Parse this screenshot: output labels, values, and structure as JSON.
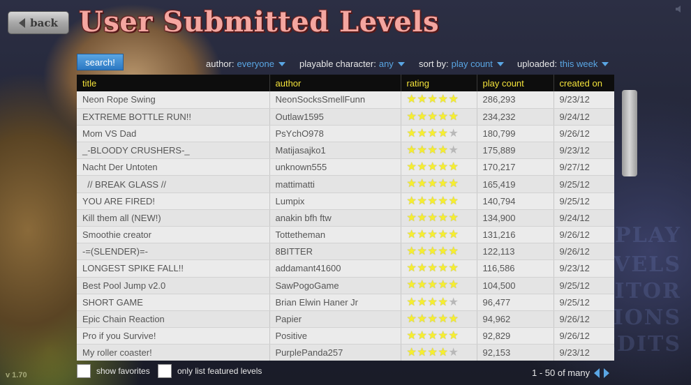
{
  "header": {
    "back_label": "back",
    "title": "User Submitted Levels"
  },
  "toolbar": {
    "search_label": "search!",
    "filters": [
      {
        "label": "author:",
        "value": "everyone"
      },
      {
        "label": "playable character:",
        "value": "any"
      },
      {
        "label": "sort by:",
        "value": "play count"
      },
      {
        "label": "uploaded:",
        "value": "this week"
      }
    ]
  },
  "table": {
    "columns": [
      "title",
      "author",
      "rating",
      "play count",
      "created on"
    ],
    "rows": [
      {
        "title": "Neon Rope Swing",
        "author": "NeonSocksSmellFunn",
        "rating": 5,
        "play_count": "286,293",
        "created": "9/23/12"
      },
      {
        "title": "EXTREME BOTTLE RUN!!",
        "author": "Outlaw1595",
        "rating": 5,
        "play_count": "234,232",
        "created": "9/24/12"
      },
      {
        "title": "Mom VS Dad",
        "author": "PsYchO978",
        "rating": 4,
        "play_count": "180,799",
        "created": "9/26/12"
      },
      {
        "title": "_-BLOODY CRUSHERS-_",
        "author": "Matijasajko1",
        "rating": 4,
        "play_count": "175,889",
        "created": "9/23/12"
      },
      {
        "title": "Nacht Der Untoten",
        "author": "unknown555",
        "rating": 5,
        "play_count": "170,217",
        "created": "9/27/12"
      },
      {
        "title": "  // BREAK GLASS //",
        "author": "mattimatti",
        "rating": 5,
        "play_count": "165,419",
        "created": "9/25/12"
      },
      {
        "title": "YOU ARE FIRED!",
        "author": "Lumpix",
        "rating": 5,
        "play_count": "140,794",
        "created": "9/25/12"
      },
      {
        "title": "Kill them all (NEW!)",
        "author": "anakin bfh ftw",
        "rating": 5,
        "play_count": "134,900",
        "created": "9/24/12"
      },
      {
        "title": "Smoothie creator",
        "author": "Tottetheman",
        "rating": 5,
        "play_count": "131,216",
        "created": "9/26/12"
      },
      {
        "title": "-=(SLENDER)=-",
        "author": "8BITTER",
        "rating": 5,
        "play_count": "122,113",
        "created": "9/26/12"
      },
      {
        "title": "LONGEST SPIKE FALL!!",
        "author": "addamant41600",
        "rating": 5,
        "play_count": "116,586",
        "created": "9/23/12"
      },
      {
        "title": "Best Pool Jump v2.0",
        "author": "SawPogoGame",
        "rating": 5,
        "play_count": "104,500",
        "created": "9/25/12"
      },
      {
        "title": "SHORT GAME",
        "author": "Brian Elwin Haner Jr",
        "rating": 4,
        "play_count": "96,477",
        "created": "9/25/12"
      },
      {
        "title": "Epic Chain Reaction",
        "author": "Papier",
        "rating": 5,
        "play_count": "94,962",
        "created": "9/26/12"
      },
      {
        "title": "Pro if you Survive!",
        "author": "Positive",
        "rating": 5,
        "play_count": "92,829",
        "created": "9/26/12"
      },
      {
        "title": "My roller coaster!",
        "author": "PurplePanda257",
        "rating": 4,
        "play_count": "92,153",
        "created": "9/23/12"
      }
    ]
  },
  "footer": {
    "show_favorites_label": "show favorites",
    "featured_label": "only list featured levels",
    "pagination": "1 - 50 of many",
    "version": "v 1.70"
  },
  "colors": {
    "title_pink": "#f4a6a0",
    "link_blue": "#5aa6e4",
    "header_yellow": "#f3e23a",
    "star_yellow": "#f6ee30"
  },
  "icons": {
    "back": "back-arrow-icon",
    "star": "star-icon",
    "sound": "speaker-icon"
  }
}
